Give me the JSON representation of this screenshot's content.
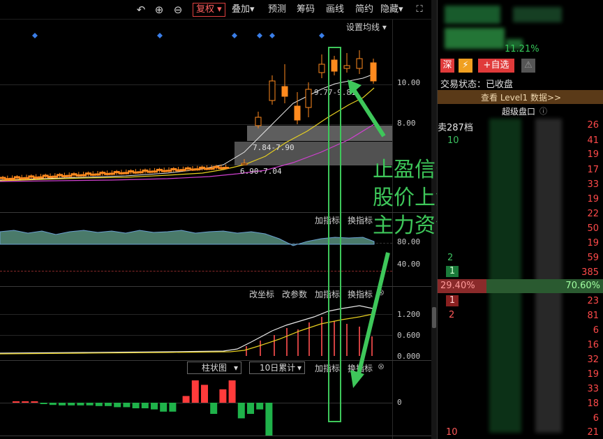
{
  "toolbar": {
    "undo_icon": "undo-icon",
    "zoom_in_icon": "zoom-in-icon",
    "zoom_out_icon": "zoom-out-icon",
    "fuquan_label": "复权",
    "overlay_label": "叠加",
    "forecast_label": "预测",
    "chips_label": "筹码",
    "draw_label": "画线",
    "simple_label": "简约",
    "hide_label": "隐藏",
    "fullscreen_icon": "fullscreen-icon"
  },
  "price_panel": {
    "ma_setting_label": "设置均线",
    "label_range_1": "9.77-9.81",
    "label_range_2": "7.84-7.90",
    "label_range_3": "6.90-7.04",
    "axis": [
      "10.00",
      "8.00"
    ]
  },
  "indicator_panel_1": {
    "add_label": "加指标",
    "switch_label": "换指标",
    "axis": [
      "80.00",
      "40.00"
    ]
  },
  "indicator_panel_2": {
    "change_axis_label": "改坐标",
    "change_param_label": "改参数",
    "add_label": "加指标",
    "switch_label": "换指标",
    "axis": [
      "1.200",
      "0.600",
      "0.000"
    ]
  },
  "indicator_panel_3": {
    "chart_type_select": "柱状图",
    "period_select": "10日累计",
    "add_label": "加指标",
    "switch_label": "换指标",
    "axis": [
      "0"
    ]
  },
  "annotation": {
    "line1": "止盈信号",
    "line2": "股价上涨",
    "line3": "主力资金流出"
  },
  "right_panel": {
    "change_pct": "11.21%",
    "tag_market": "深",
    "tag_add": "+自选",
    "status_label": "交易状态：已收盘",
    "level1_link": "查看 Level1 数据>>",
    "super_panel_label": "超级盘口",
    "sell_header": "卖287档",
    "sell_header_right": "26",
    "left_values": [
      "10",
      "2",
      "1",
      "1",
      "2",
      "10"
    ],
    "right_values": [
      "26",
      "41",
      "19",
      "17",
      "33",
      "19",
      "22",
      "50",
      "19",
      "59",
      "385",
      "23",
      "81",
      "6",
      "16",
      "32",
      "19",
      "33",
      "18",
      "6",
      "21"
    ],
    "ratio_left": "29.40%",
    "ratio_right": "70.60%"
  },
  "colors": {
    "up": "#ff3b3b",
    "down": "#1fb24a",
    "candle_up_fill": "#ff8a1e",
    "annotation": "#3ec75a"
  },
  "chart_data": [
    {
      "type": "candlestick",
      "title": "",
      "y_ticks": [
        10.0,
        8.0
      ],
      "price_ranges_labeled": [
        "9.77-9.81",
        "7.84-7.90",
        "6.90-7.04"
      ]
    },
    {
      "type": "bar",
      "title": "",
      "ylim": [
        -1,
        1
      ],
      "values": [
        0.0,
        0.0,
        0.05,
        -0.05,
        -0.1,
        -0.12,
        -0.12,
        -0.12,
        -0.12,
        -0.15,
        -0.15,
        -0.2,
        -0.2,
        -0.25,
        -0.25,
        -0.3,
        -0.4,
        -0.4,
        0.3,
        1.0,
        0.8,
        -0.5,
        0.6,
        1.0,
        -0.7,
        -0.5,
        -0.3,
        -1.5
      ]
    }
  ]
}
